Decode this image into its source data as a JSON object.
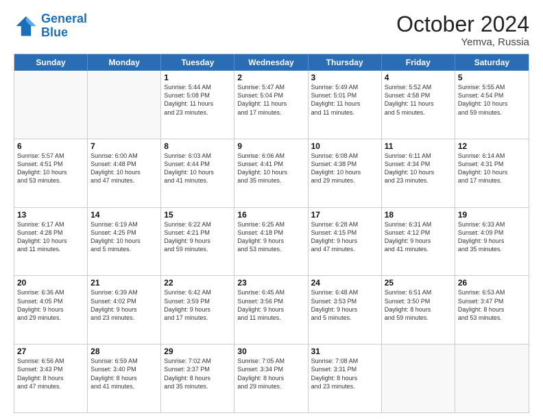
{
  "logo": {
    "line1": "General",
    "line2": "Blue"
  },
  "title": "October 2024",
  "location": "Yemva, Russia",
  "weekdays": [
    "Sunday",
    "Monday",
    "Tuesday",
    "Wednesday",
    "Thursday",
    "Friday",
    "Saturday"
  ],
  "rows": [
    [
      {
        "day": "",
        "lines": [],
        "empty": true
      },
      {
        "day": "",
        "lines": [],
        "empty": true
      },
      {
        "day": "1",
        "lines": [
          "Sunrise: 5:44 AM",
          "Sunset: 5:08 PM",
          "Daylight: 11 hours",
          "and 23 minutes."
        ]
      },
      {
        "day": "2",
        "lines": [
          "Sunrise: 5:47 AM",
          "Sunset: 5:04 PM",
          "Daylight: 11 hours",
          "and 17 minutes."
        ]
      },
      {
        "day": "3",
        "lines": [
          "Sunrise: 5:49 AM",
          "Sunset: 5:01 PM",
          "Daylight: 11 hours",
          "and 11 minutes."
        ]
      },
      {
        "day": "4",
        "lines": [
          "Sunrise: 5:52 AM",
          "Sunset: 4:58 PM",
          "Daylight: 11 hours",
          "and 5 minutes."
        ]
      },
      {
        "day": "5",
        "lines": [
          "Sunrise: 5:55 AM",
          "Sunset: 4:54 PM",
          "Daylight: 10 hours",
          "and 59 minutes."
        ]
      }
    ],
    [
      {
        "day": "6",
        "lines": [
          "Sunrise: 5:57 AM",
          "Sunset: 4:51 PM",
          "Daylight: 10 hours",
          "and 53 minutes."
        ]
      },
      {
        "day": "7",
        "lines": [
          "Sunrise: 6:00 AM",
          "Sunset: 4:48 PM",
          "Daylight: 10 hours",
          "and 47 minutes."
        ]
      },
      {
        "day": "8",
        "lines": [
          "Sunrise: 6:03 AM",
          "Sunset: 4:44 PM",
          "Daylight: 10 hours",
          "and 41 minutes."
        ]
      },
      {
        "day": "9",
        "lines": [
          "Sunrise: 6:06 AM",
          "Sunset: 4:41 PM",
          "Daylight: 10 hours",
          "and 35 minutes."
        ]
      },
      {
        "day": "10",
        "lines": [
          "Sunrise: 6:08 AM",
          "Sunset: 4:38 PM",
          "Daylight: 10 hours",
          "and 29 minutes."
        ]
      },
      {
        "day": "11",
        "lines": [
          "Sunrise: 6:11 AM",
          "Sunset: 4:34 PM",
          "Daylight: 10 hours",
          "and 23 minutes."
        ]
      },
      {
        "day": "12",
        "lines": [
          "Sunrise: 6:14 AM",
          "Sunset: 4:31 PM",
          "Daylight: 10 hours",
          "and 17 minutes."
        ]
      }
    ],
    [
      {
        "day": "13",
        "lines": [
          "Sunrise: 6:17 AM",
          "Sunset: 4:28 PM",
          "Daylight: 10 hours",
          "and 11 minutes."
        ]
      },
      {
        "day": "14",
        "lines": [
          "Sunrise: 6:19 AM",
          "Sunset: 4:25 PM",
          "Daylight: 10 hours",
          "and 5 minutes."
        ]
      },
      {
        "day": "15",
        "lines": [
          "Sunrise: 6:22 AM",
          "Sunset: 4:21 PM",
          "Daylight: 9 hours",
          "and 59 minutes."
        ]
      },
      {
        "day": "16",
        "lines": [
          "Sunrise: 6:25 AM",
          "Sunset: 4:18 PM",
          "Daylight: 9 hours",
          "and 53 minutes."
        ]
      },
      {
        "day": "17",
        "lines": [
          "Sunrise: 6:28 AM",
          "Sunset: 4:15 PM",
          "Daylight: 9 hours",
          "and 47 minutes."
        ]
      },
      {
        "day": "18",
        "lines": [
          "Sunrise: 6:31 AM",
          "Sunset: 4:12 PM",
          "Daylight: 9 hours",
          "and 41 minutes."
        ]
      },
      {
        "day": "19",
        "lines": [
          "Sunrise: 6:33 AM",
          "Sunset: 4:09 PM",
          "Daylight: 9 hours",
          "and 35 minutes."
        ]
      }
    ],
    [
      {
        "day": "20",
        "lines": [
          "Sunrise: 6:36 AM",
          "Sunset: 4:05 PM",
          "Daylight: 9 hours",
          "and 29 minutes."
        ]
      },
      {
        "day": "21",
        "lines": [
          "Sunrise: 6:39 AM",
          "Sunset: 4:02 PM",
          "Daylight: 9 hours",
          "and 23 minutes."
        ]
      },
      {
        "day": "22",
        "lines": [
          "Sunrise: 6:42 AM",
          "Sunset: 3:59 PM",
          "Daylight: 9 hours",
          "and 17 minutes."
        ]
      },
      {
        "day": "23",
        "lines": [
          "Sunrise: 6:45 AM",
          "Sunset: 3:56 PM",
          "Daylight: 9 hours",
          "and 11 minutes."
        ]
      },
      {
        "day": "24",
        "lines": [
          "Sunrise: 6:48 AM",
          "Sunset: 3:53 PM",
          "Daylight: 9 hours",
          "and 5 minutes."
        ]
      },
      {
        "day": "25",
        "lines": [
          "Sunrise: 6:51 AM",
          "Sunset: 3:50 PM",
          "Daylight: 8 hours",
          "and 59 minutes."
        ]
      },
      {
        "day": "26",
        "lines": [
          "Sunrise: 6:53 AM",
          "Sunset: 3:47 PM",
          "Daylight: 8 hours",
          "and 53 minutes."
        ]
      }
    ],
    [
      {
        "day": "27",
        "lines": [
          "Sunrise: 6:56 AM",
          "Sunset: 3:43 PM",
          "Daylight: 8 hours",
          "and 47 minutes."
        ]
      },
      {
        "day": "28",
        "lines": [
          "Sunrise: 6:59 AM",
          "Sunset: 3:40 PM",
          "Daylight: 8 hours",
          "and 41 minutes."
        ]
      },
      {
        "day": "29",
        "lines": [
          "Sunrise: 7:02 AM",
          "Sunset: 3:37 PM",
          "Daylight: 8 hours",
          "and 35 minutes."
        ]
      },
      {
        "day": "30",
        "lines": [
          "Sunrise: 7:05 AM",
          "Sunset: 3:34 PM",
          "Daylight: 8 hours",
          "and 29 minutes."
        ]
      },
      {
        "day": "31",
        "lines": [
          "Sunrise: 7:08 AM",
          "Sunset: 3:31 PM",
          "Daylight: 8 hours",
          "and 23 minutes."
        ]
      },
      {
        "day": "",
        "lines": [],
        "empty": true
      },
      {
        "day": "",
        "lines": [],
        "empty": true
      }
    ]
  ]
}
